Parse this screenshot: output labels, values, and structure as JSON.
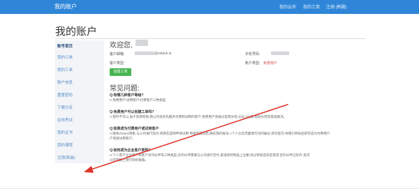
{
  "topnav": {
    "brand": "我的账户",
    "items": [
      "我的云市",
      "我的工单",
      "注销 (韩晨)"
    ]
  },
  "page_title": "我的账户",
  "sidebar": {
    "items": [
      {
        "label": "账号首页",
        "active": true
      },
      {
        "label": "我的订单",
        "active": false
      },
      {
        "label": "我的工单",
        "active": false
      },
      {
        "label": "账户信息",
        "active": false
      },
      {
        "label": "重置密码",
        "active": false
      },
      {
        "label": "下载分享",
        "active": false
      },
      {
        "label": "在线考试",
        "active": false
      },
      {
        "label": "我的证书",
        "active": false
      },
      {
        "label": "我的课程",
        "active": false
      },
      {
        "label": "注销(韩晨)",
        "active": false
      }
    ]
  },
  "welcome": "欢迎您,",
  "account": {
    "email_label": "客户邮箱:",
    "email_value": "@zstack.io",
    "phone_label": "手机号码:",
    "type_label": "客户类型:",
    "status_label": "账户类型:",
    "status_value": "免费用户"
  },
  "create_ticket_label": "创建工单",
  "faq": {
    "heading": "常见问题:",
    "items": [
      {
        "q": "Q:有哪几种客户等级?",
        "a": [
          "A:免费用户/试用客户/付费客户三种类型"
        ]
      },
      {
        "q": "Q:免费用户可以创建工单吗?",
        "a": [
          "A:暂时不可以,由于资源有限,我公司会优先服务付费和试用的客户,免费用户请通过官网文档,论坛,QQ群,帮助文档等渠道解决。"
        ]
      },
      {
        "q": "Q:如果成为付费用户或试用客户",
        "a": [
          "A:联系ZStack销售,与公司进行签约;或者在官网申请试用,申请完成以后,确在我的账号->个人信息页面填写合同编号,即可提交;待我们审核后即可成为付费用户",
          "户或者试用客户。"
        ]
      },
      {
        "q": "Q:如何成为企业客户类型?",
        "a": [
          "A:个人客户企业客户和客户合作伙伴等三种类型,合作伙伴需要与公司进行签约,渠道请到制品上注册,经过审核后状态变成'合作伙伴已签约',就可",
          "以在网站上进行商机报备。"
        ]
      }
    ]
  },
  "colors": {
    "nav_bg": "#2f86d8",
    "button_green": "#46b450",
    "status_red": "#d9534f",
    "annotation_arrow": "#e0352b"
  }
}
